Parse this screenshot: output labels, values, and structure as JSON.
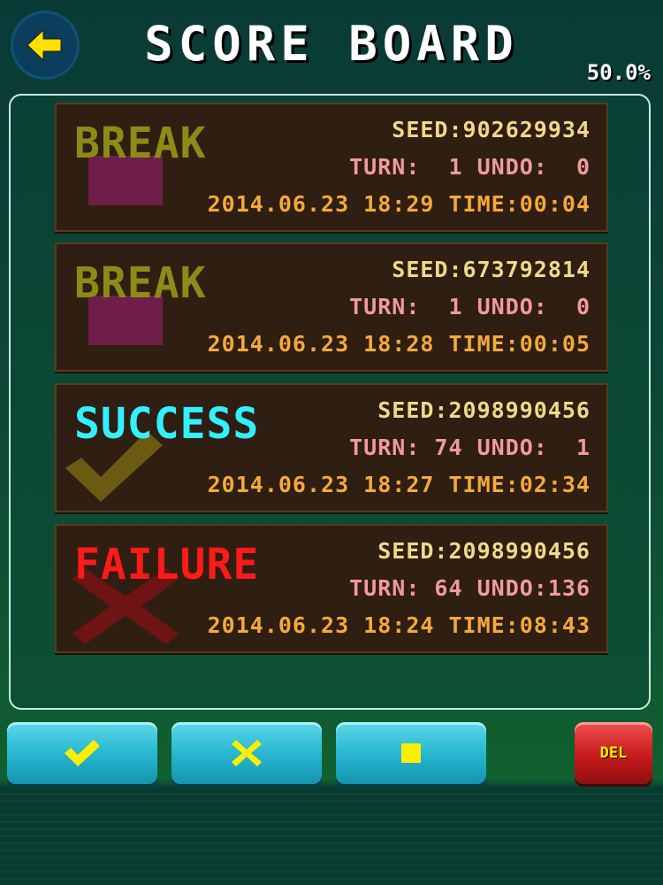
{
  "header": {
    "title": "SCORE BOARD",
    "percent": "50.0%",
    "back_icon": "arrow-left-icon"
  },
  "records": [
    {
      "status": "BREAK",
      "status_color": "#8e8a16",
      "symbol": "square-icon",
      "symbol_color": "#6e1e48",
      "seed_line": "SEED:902629934",
      "turn_line": "TURN:  1 UNDO:  0",
      "time_line": "2014.06.23 18:29 TIME:00:04"
    },
    {
      "status": "BREAK",
      "status_color": "#8e8a16",
      "symbol": "square-icon",
      "symbol_color": "#6e1e48",
      "seed_line": "SEED:673792814",
      "turn_line": "TURN:  1 UNDO:  0",
      "time_line": "2014.06.23 18:28 TIME:00:05"
    },
    {
      "status": "SUCCESS",
      "status_color": "#33f0ff",
      "symbol": "check-icon",
      "symbol_color": "#6b5a12",
      "seed_line": "SEED:2098990456",
      "turn_line": "TURN: 74 UNDO:  1",
      "time_line": "2014.06.23 18:27 TIME:02:34"
    },
    {
      "status": "FAILURE",
      "status_color": "#ff1a1a",
      "symbol": "cross-icon",
      "symbol_color": "#6e1414",
      "seed_line": "SEED:2098990456",
      "turn_line": "TURN: 64 UNDO:136",
      "time_line": "2014.06.23 18:24 TIME:08:43"
    }
  ],
  "toolbar": {
    "success_filter_icon": "check-icon",
    "failure_filter_icon": "cross-icon",
    "break_filter_icon": "square-icon",
    "delete_label": "DEL",
    "icon_color": "#ffee00"
  }
}
